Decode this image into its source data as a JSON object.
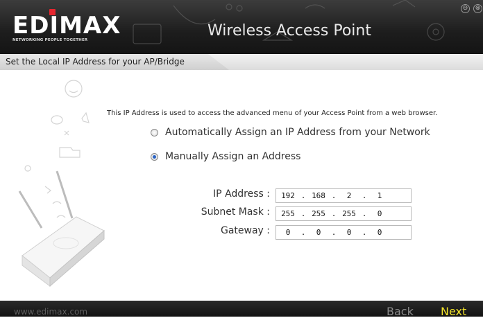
{
  "header": {
    "brand": "EDIMAX",
    "tagline": "NETWORKING PEOPLE TOGETHER",
    "title": "Wireless Access Point",
    "minimize_symbol": "⊖",
    "close_symbol": "⊗"
  },
  "subtitle": "Set the Local IP Address for your AP/Bridge",
  "description": "This IP Address is used to access the advanced menu of your Access Point from a web browser.",
  "options": [
    {
      "label": "Automatically Assign an IP Address from your Network",
      "checked": false
    },
    {
      "label": "Manually Assign an Address",
      "checked": true
    }
  ],
  "fields": [
    {
      "label": "IP Address :",
      "octets": [
        "192",
        "168",
        "2",
        "1"
      ]
    },
    {
      "label": "Subnet Mask :",
      "octets": [
        "255",
        "255",
        "255",
        "0"
      ]
    },
    {
      "label": "Gateway :",
      "octets": [
        "0",
        "0",
        "0",
        "0"
      ]
    }
  ],
  "footer": {
    "website": "www.edimax.com",
    "back_label": "Back",
    "next_label": "Next"
  },
  "colors": {
    "accent_next": "#f2e32a",
    "logo_dot": "#e6262f",
    "radio_selected": "#2a63c4"
  }
}
